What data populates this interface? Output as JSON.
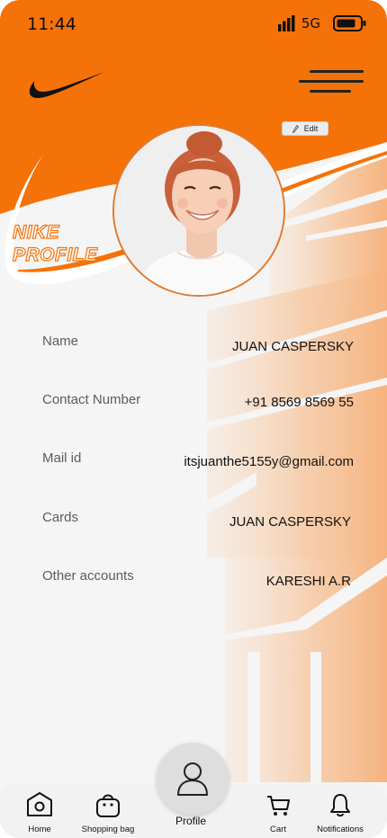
{
  "status_bar": {
    "time": "11:44",
    "network": "5G"
  },
  "header": {
    "edit_label": "Edit"
  },
  "hero": {
    "title_line1": "NIKE",
    "title_line2": "PROFILE"
  },
  "fields": [
    {
      "label": "Name",
      "value": "JUAN CASPERSKY"
    },
    {
      "label": "Contact Number",
      "value": "+91 8569 8569 55"
    },
    {
      "label": "Mail id",
      "value": "itsjuanthe5155y@gmail.com"
    },
    {
      "label": "Cards",
      "value": "JUAN CASPERSKY"
    },
    {
      "label": "Other accounts",
      "value": "KARESHI A.R"
    }
  ],
  "bottom_nav": {
    "home": "Home",
    "shopping_bag": "Shopping bag",
    "profile": "Profile",
    "cart": "Cart",
    "notifications": "Notifications"
  },
  "colors": {
    "brand_orange": "#f57208",
    "watermark": "#f6c7a0"
  },
  "icons": [
    "nike-swoosh-logo",
    "hamburger-menu-icon",
    "pencil-icon",
    "home-icon",
    "shopping-bag-icon",
    "user-icon",
    "cart-icon",
    "bell-icon"
  ]
}
